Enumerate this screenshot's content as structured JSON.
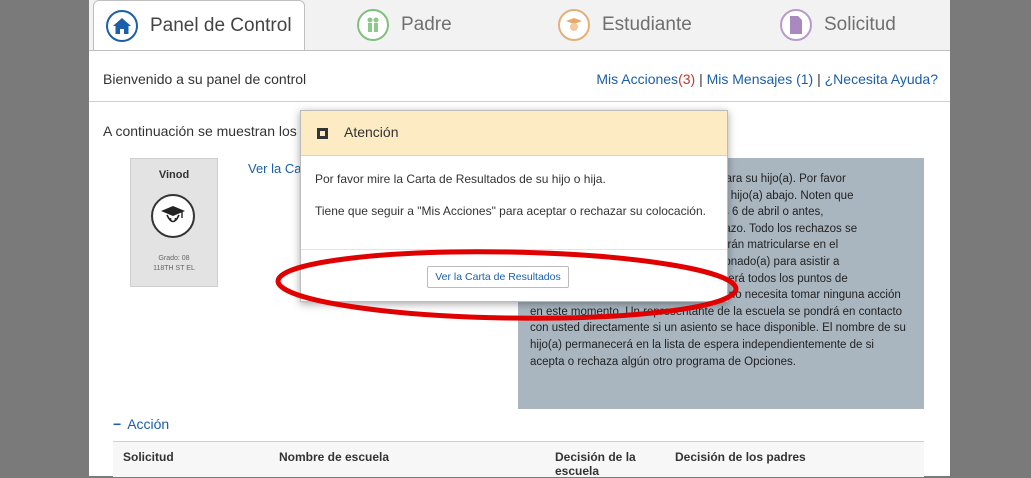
{
  "tabs": [
    {
      "label": "Panel de Control",
      "icon": "home-icon"
    },
    {
      "label": "Padre",
      "icon": "family-icon"
    },
    {
      "label": "Estudiante",
      "icon": "student-icon"
    },
    {
      "label": "Solicitud",
      "icon": "document-icon"
    }
  ],
  "header": {
    "welcome": "Bienvenido a su panel de control",
    "mis_acciones": "Mis Acciones",
    "mis_acciones_count": "(3)",
    "sep1": " | ",
    "mis_mensajes": "Mis Mensajes",
    "mis_mensajes_count": " (1)",
    "sep2": " | ",
    "ayuda": "¿Necesita Ayuda?"
  },
  "main": {
    "below_text": "A continuación se muestran los p",
    "letter_link": "Ver la Ca"
  },
  "student": {
    "name": "Vinod",
    "grade": "Grado: 08",
    "school": "118TH ST EL"
  },
  "info": {
    "lines": [
      "opciones para su hijo(a). Por favor",
      "ma para su hijo(a) abajo. Noten que",
      "e el viernes 6 de abril o antes,",
      "no un rechazo. Todo los rechazos se",
      "que no podrán matricularse en el",
      "fue seleccionado(a) para asistir a",
      "hijo(a) perderá todos los puntos de",
      "prioridad. Si está en la lista de espera, no necesita tomar ninguna acción",
      "en este momento. Un representante de la escuela se pondrá en contacto",
      "con usted directamente si un asiento se hace disponible. El nombre de su",
      "hijo(a) permanecerá en la lista de espera independientemente de si",
      "acepta o rechaza algún otro programa de Opciones."
    ]
  },
  "accion": {
    "toggle": "−",
    "label": "Acción"
  },
  "table": {
    "headers": [
      "Solicitud",
      "Nombre de escuela",
      "Decisión de la escuela",
      "Decisión de los padres"
    ]
  },
  "modal": {
    "title": "Atención",
    "message1": "Por favor mire la Carta de Resultados de su hijo o hija.",
    "message2": "Tiene que seguir a \"Mis Acciones\" para aceptar o rechazar su colocación.",
    "button": "Ver la Carta de Resultados"
  },
  "colors": {
    "annotation": "#e00000",
    "modal_header": "#fcebc3",
    "info_box": "#a9b6c0",
    "link": "#1b5fa8"
  }
}
